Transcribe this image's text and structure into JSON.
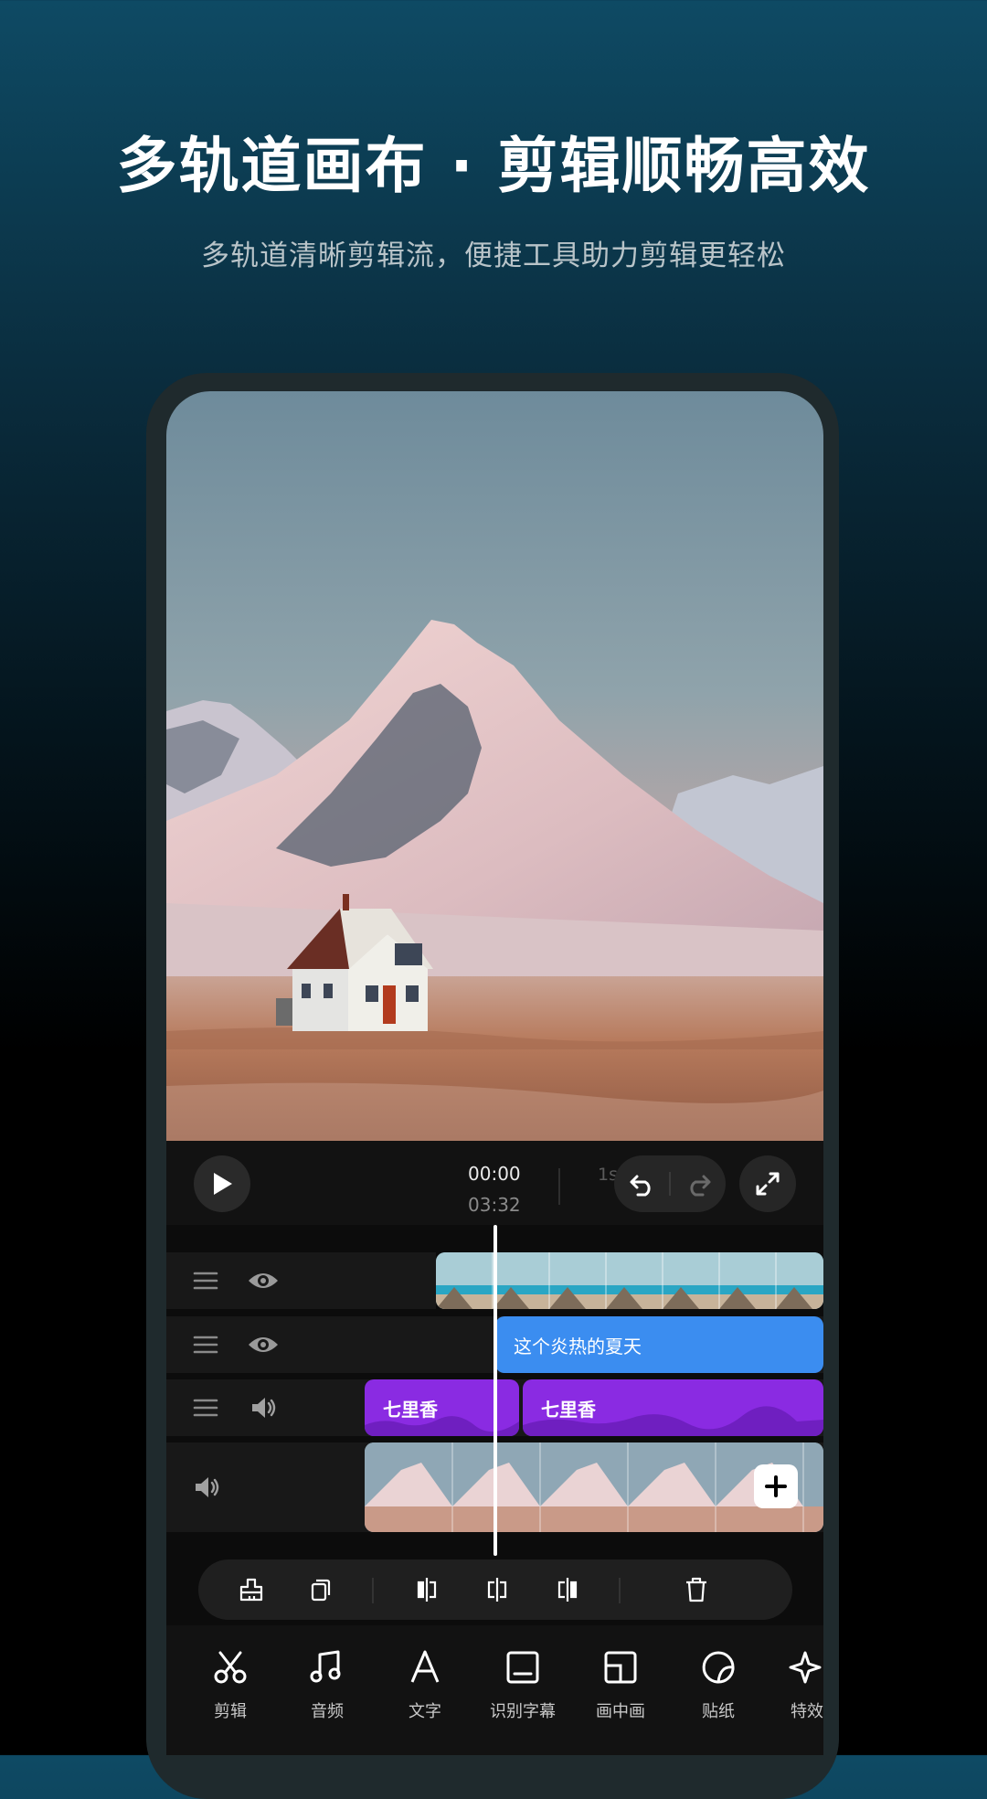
{
  "hero": {
    "title": "多轨道画布 · 剪辑顺畅高效",
    "subtitle": "多轨道清晰剪辑流，便捷工具助力剪辑更轻松"
  },
  "player": {
    "current_time": "00:00",
    "total_time": "03:32",
    "ruler_label": "1s"
  },
  "timeline": {
    "text_clip": "这个炎热的夏天",
    "audio_clips": [
      "七里香",
      "七里香"
    ]
  },
  "tools": [
    {
      "label": "剪辑",
      "icon": "scissors-icon"
    },
    {
      "label": "音频",
      "icon": "music-note-icon"
    },
    {
      "label": "文字",
      "icon": "text-icon"
    },
    {
      "label": "识别字幕",
      "icon": "subtitle-icon"
    },
    {
      "label": "画中画",
      "icon": "picture-in-picture-icon"
    },
    {
      "label": "贴纸",
      "icon": "sticker-icon"
    },
    {
      "label": "特效",
      "icon": "effects-icon"
    }
  ],
  "colors": {
    "text_clip": "#3b8df0",
    "audio_clip": "#8a2be2",
    "accent": "#ffffff"
  }
}
